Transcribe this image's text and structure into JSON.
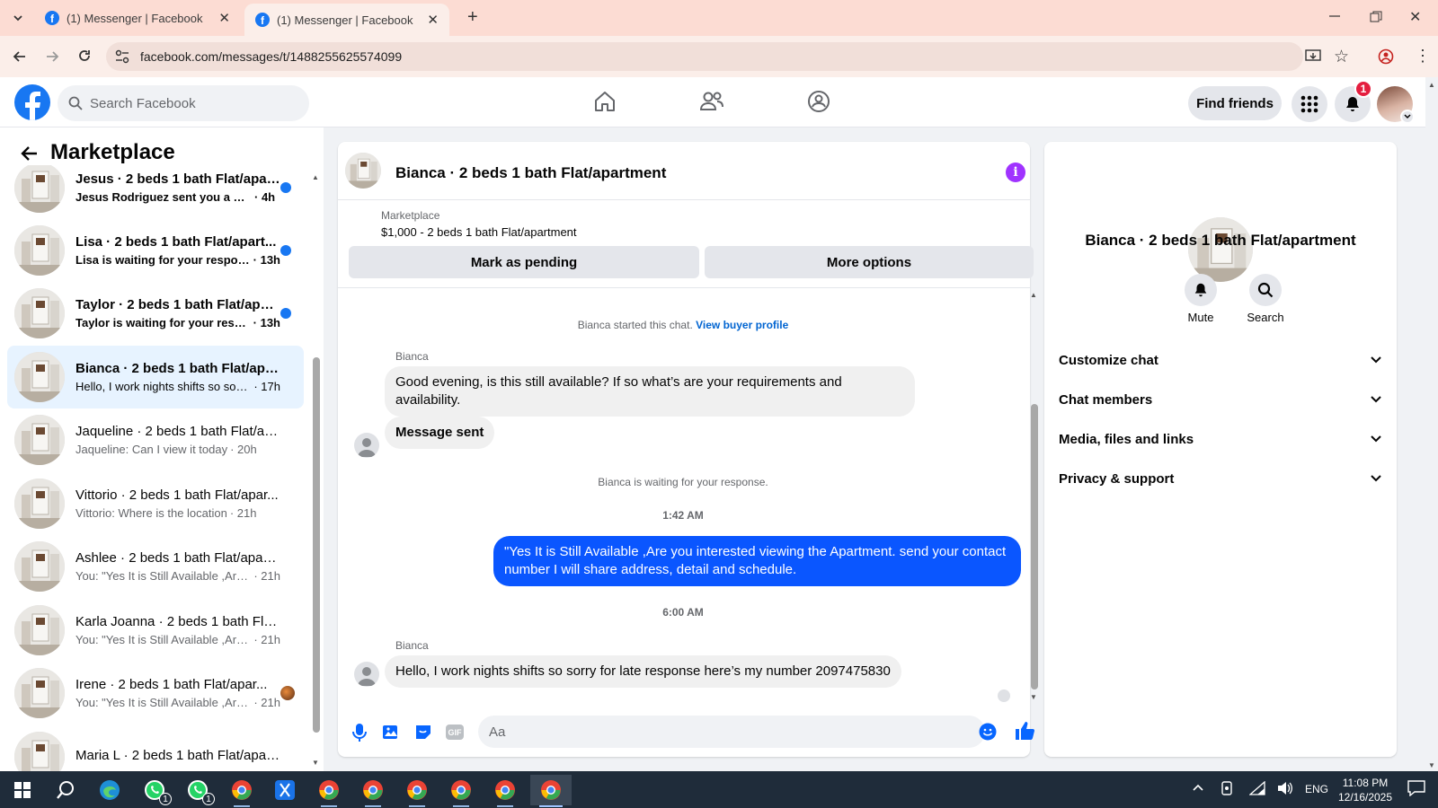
{
  "browser": {
    "tabs": [
      {
        "title": "(1) Messenger | Facebook"
      },
      {
        "title": "(1) Messenger | Facebook"
      }
    ],
    "url": "facebook.com/messages/t/1488255625574099"
  },
  "header": {
    "search_placeholder": "Search Facebook",
    "find_friends": "Find friends",
    "notification_count": "1"
  },
  "sidebar": {
    "title": "Marketplace",
    "conversations": [
      {
        "title": "Jesus · 2 beds 1 bath Flat/apart...",
        "snippet": "Jesus Rodriguez sent you a mes...",
        "time": "· 4h",
        "unread": true
      },
      {
        "title": "Lisa · 2 beds 1 bath Flat/apart...",
        "snippet": "Lisa is waiting for your response.",
        "time": "· 13h",
        "unread": true
      },
      {
        "title": "Taylor · 2 beds 1 bath Flat/apar...",
        "snippet": "Taylor is waiting for your respo...",
        "time": "· 13h",
        "unread": true
      },
      {
        "title": "Bianca · 2 beds 1 bath Flat/apart...",
        "snippet": "Hello, I work nights shifts so sorry ...",
        "time": "· 17h",
        "unread": false,
        "selected": true
      },
      {
        "title": "Jaqueline · 2 beds 1 bath Flat/ap...",
        "snippet": "Jaqueline: Can I view it today",
        "time": "· 20h",
        "unread": false
      },
      {
        "title": "Vittorio · 2 beds 1 bath Flat/apar...",
        "snippet": "Vittorio: Where is the location",
        "time": "· 21h",
        "unread": false
      },
      {
        "title": "Ashlee · 2 beds 1 bath Flat/apart...",
        "snippet": "You: \"Yes It is Still Available ,Are yo...",
        "time": "· 21h",
        "unread": false
      },
      {
        "title": "Karla Joanna · 2 beds 1 bath Flat...",
        "snippet": "You: \"Yes It is Still Available ,Are yo...",
        "time": "· 21h",
        "unread": false
      },
      {
        "title": "Irene · 2 beds 1 bath Flat/apar...",
        "snippet": "You: \"Yes It is Still Available ,Are...",
        "time": "· 21h",
        "unread": false
      },
      {
        "title": "Maria L · 2 beds 1 bath Flat/apar...",
        "snippet": "",
        "time": "",
        "unread": false
      }
    ]
  },
  "chat": {
    "title": "Bianca · 2 beds 1 bath Flat/apartment",
    "listing_source": "Marketplace",
    "listing_detail": "$1,000 - 2 beds 1 bath Flat/apartment",
    "mark_pending": "Mark as pending",
    "more_options": "More options",
    "started_text": "Bianca started this chat.",
    "view_profile": "View buyer profile",
    "sender_name": "Bianca",
    "msg1": "Good evening, is this still available? If so what’s are your requirements and availability.",
    "msg2": "Message sent",
    "waiting_text": "Bianca is waiting for your response.",
    "time1": "1:42 AM",
    "msg3": "\"Yes It is Still Available ,Are you interested viewing the Apartment. send your contact number I will share address, detail and schedule.",
    "time2": "6:00 AM",
    "msg4": "Hello, I work nights shifts so sorry for late response here’s my number 2097475830",
    "composer_placeholder": "Aa"
  },
  "details": {
    "title": "Bianca · 2 beds 1 bath Flat/apartment",
    "mute": "Mute",
    "search": "Search",
    "sections": [
      "Customize chat",
      "Chat members",
      "Media, files and links",
      "Privacy & support"
    ]
  },
  "taskbar": {
    "language": "ENG",
    "time": "11:08 PM",
    "date": "12/16/2025",
    "whatsapp_badge": "1"
  },
  "colors": {
    "accent": "#1877f2",
    "outgoing_bubble": "#0a56ff",
    "selected_row": "#e7f3ff",
    "info_icon": "#a033ff"
  }
}
